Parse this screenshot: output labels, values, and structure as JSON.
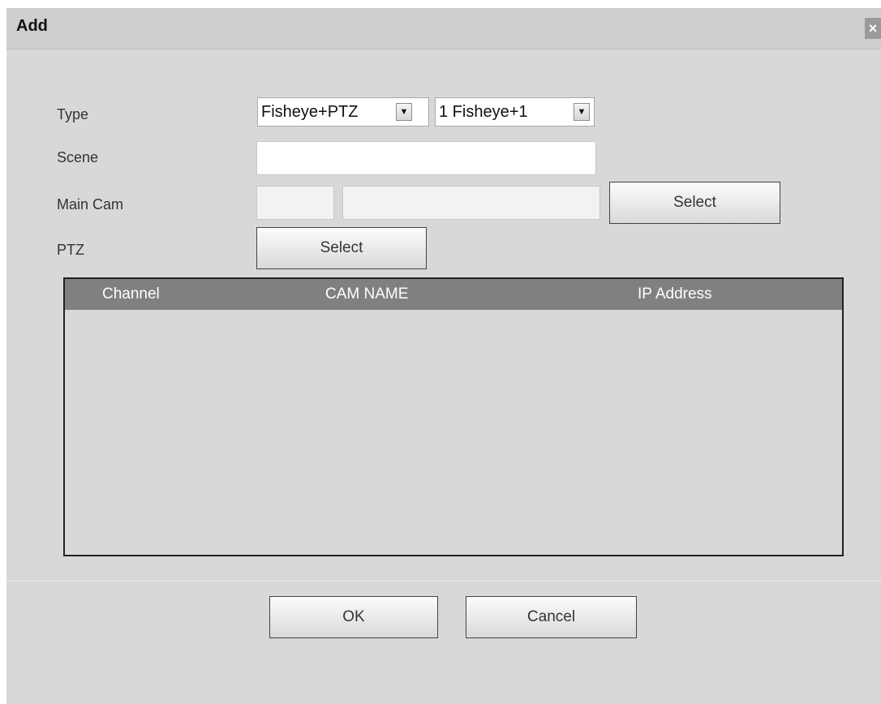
{
  "dialog": {
    "title": "Add",
    "close_glyph": "×"
  },
  "form": {
    "type_label": "Type",
    "type_value": "Fisheye+PTZ",
    "mode_value": "1 Fisheye+1",
    "scene_label": "Scene",
    "scene_value": "",
    "main_cam_label": "Main Cam",
    "main_cam_channel": "",
    "main_cam_name": "",
    "main_cam_select": "Select",
    "ptz_label": "PTZ",
    "ptz_select": "Select"
  },
  "table": {
    "columns": [
      "Channel",
      "CAM NAME",
      "IP Address"
    ],
    "rows": []
  },
  "footer": {
    "ok_label": "OK",
    "cancel_label": "Cancel"
  },
  "icons": {
    "dropdown": "chevron-down-icon",
    "close": "close-icon"
  }
}
